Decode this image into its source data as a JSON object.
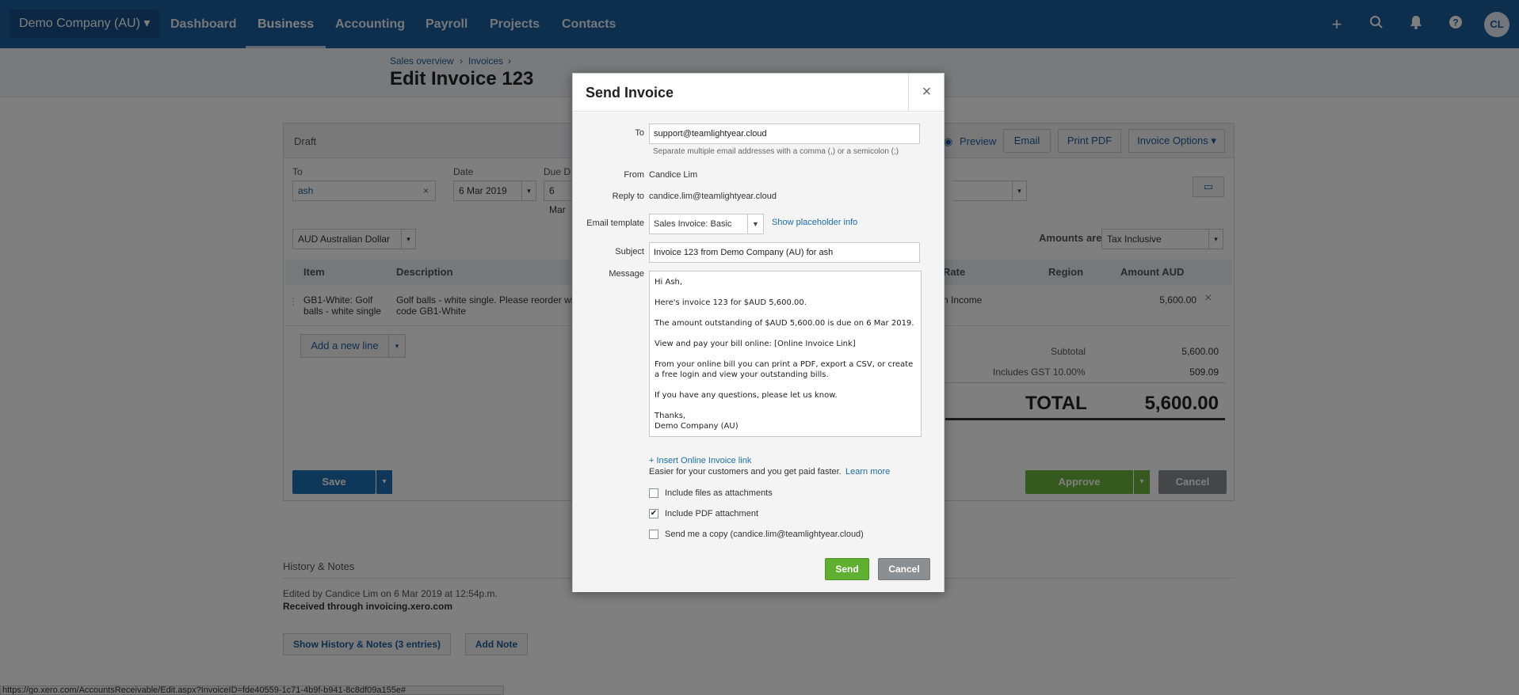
{
  "nav": {
    "org": "Demo Company (AU)",
    "links": [
      "Dashboard",
      "Business",
      "Accounting",
      "Payroll",
      "Projects",
      "Contacts"
    ],
    "active": "Business",
    "avatar": "CL"
  },
  "breadcrumb": [
    "Sales overview",
    "Invoices"
  ],
  "page_title": "Edit Invoice 123",
  "invoice": {
    "status": "Draft",
    "toolbar": {
      "preview": "Preview",
      "email": "Email",
      "print_pdf": "Print PDF",
      "options": "Invoice Options"
    },
    "to_label": "To",
    "to_value": "ash",
    "date_label": "Date",
    "date_value": "6 Mar 2019",
    "due_label": "Due D",
    "due_value": "6 Mar",
    "currency": "AUD Australian Dollar",
    "amounts_are_label": "Amounts are",
    "amounts_are_value": "Tax Inclusive",
    "columns": [
      "Item",
      "Description",
      "Rate",
      "Region",
      "Amount AUD"
    ],
    "line": {
      "item": "GB1-White: Golf balls - white single",
      "description": "Golf balls - white single. Please reorder wi code GB1-White",
      "account": "n Income",
      "amount": "5,600.00"
    },
    "add_line": "Add a new line",
    "subtotal_label": "Subtotal",
    "subtotal": "5,600.00",
    "gst_label": "Includes GST 10.00%",
    "gst": "509.09",
    "total_label": "TOTAL",
    "total": "5,600.00",
    "save": "Save",
    "approve": "Approve",
    "cancel": "Cancel"
  },
  "history": {
    "title": "History & Notes",
    "edited": "Edited by Candice Lim on 6 Mar 2019 at 12:54p.m.",
    "received": "Received through invoicing.xero.com",
    "show_btn": "Show History & Notes (3 entries)",
    "add_note": "Add Note"
  },
  "statusbar": "https://go.xero.com/AccountsReceivable/Edit.aspx?InvoiceID=fde40559-1c71-4b9f-b941-8c8df09a155e#",
  "dialog": {
    "title": "Send Invoice",
    "close": "×",
    "to_label": "To",
    "to_value": "support@teamlightyear.cloud",
    "to_help": "Separate multiple email addresses with a comma (,) or a semicolon (;)",
    "from_label": "From",
    "from_value": "Candice Lim",
    "reply_label": "Reply to",
    "reply_value": "candice.lim@teamlightyear.cloud",
    "template_label": "Email template",
    "template_value": "Sales Invoice: Basic",
    "placeholder_link": "Show placeholder info",
    "subject_label": "Subject",
    "subject_value": "Invoice 123 from Demo Company (AU) for ash",
    "message_label": "Message",
    "message": [
      "Hi Ash,",
      "Here's invoice 123 for $AUD 5,600.00.",
      "The amount outstanding of $AUD 5,600.00 is due on 6 Mar 2019.",
      "View and pay your bill online: [Online Invoice Link]",
      "From your online bill you can print a PDF, export a CSV, or create a free login and view your outstanding bills.",
      "If you have any questions, please let us know.",
      "Thanks,\nDemo Company (AU)"
    ],
    "insert_link": "+ Insert Online Invoice link",
    "faster_text": "Easier for your customers and you get paid faster.",
    "learn_more": "Learn more",
    "checkboxes": [
      {
        "label": "Include files as attachments",
        "checked": false
      },
      {
        "label": "Include PDF attachment",
        "checked": true
      },
      {
        "label": "Send me a copy (candice.lim@teamlightyear.cloud)",
        "checked": false
      }
    ],
    "send": "Send",
    "cancel": "Cancel"
  }
}
